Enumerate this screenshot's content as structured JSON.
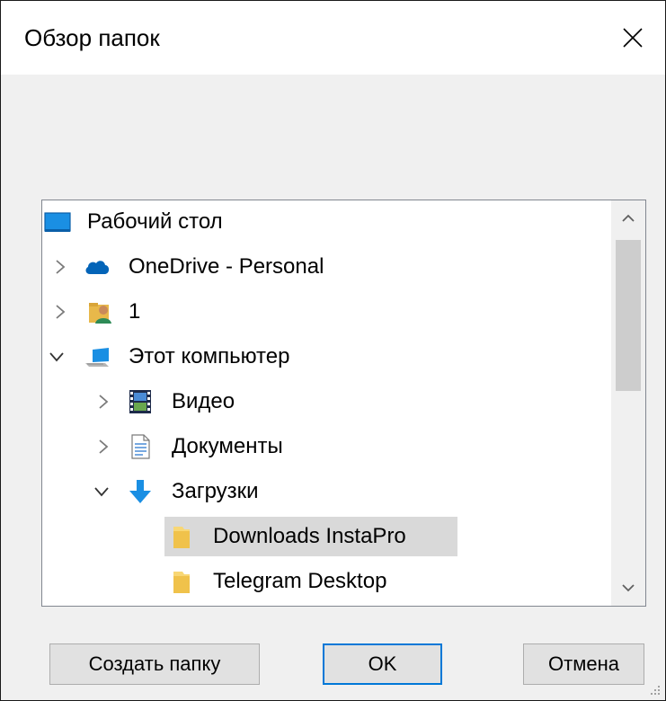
{
  "window": {
    "title": "Обзор папок"
  },
  "tree": {
    "items": [
      {
        "label": "Рабочий стол",
        "icon": "desktop-icon",
        "expander": "none"
      },
      {
        "label": "OneDrive - Personal",
        "icon": "onedrive-cloud-icon",
        "expander": "collapsed"
      },
      {
        "label": "1",
        "icon": "user-folder-icon",
        "expander": "collapsed"
      },
      {
        "label": "Этот компьютер",
        "icon": "computer-icon",
        "expander": "expanded"
      },
      {
        "label": "Видео",
        "icon": "video-folder-icon",
        "expander": "collapsed"
      },
      {
        "label": "Документы",
        "icon": "documents-folder-icon",
        "expander": "collapsed"
      },
      {
        "label": "Загрузки",
        "icon": "downloads-arrow-icon",
        "expander": "expanded"
      },
      {
        "label": "Downloads InstaPro",
        "icon": "folder-icon",
        "expander": "none",
        "selected": true
      },
      {
        "label": "Telegram Desktop",
        "icon": "folder-icon",
        "expander": "none"
      }
    ]
  },
  "buttons": {
    "new_folder": "Создать папку",
    "ok": "OK",
    "cancel": "Отмена"
  },
  "colors": {
    "selection": "#d9d9d9",
    "default_button_border": "#0078d7",
    "onedrive_blue": "#0364b8",
    "folder_yellow": "#f8d775"
  }
}
